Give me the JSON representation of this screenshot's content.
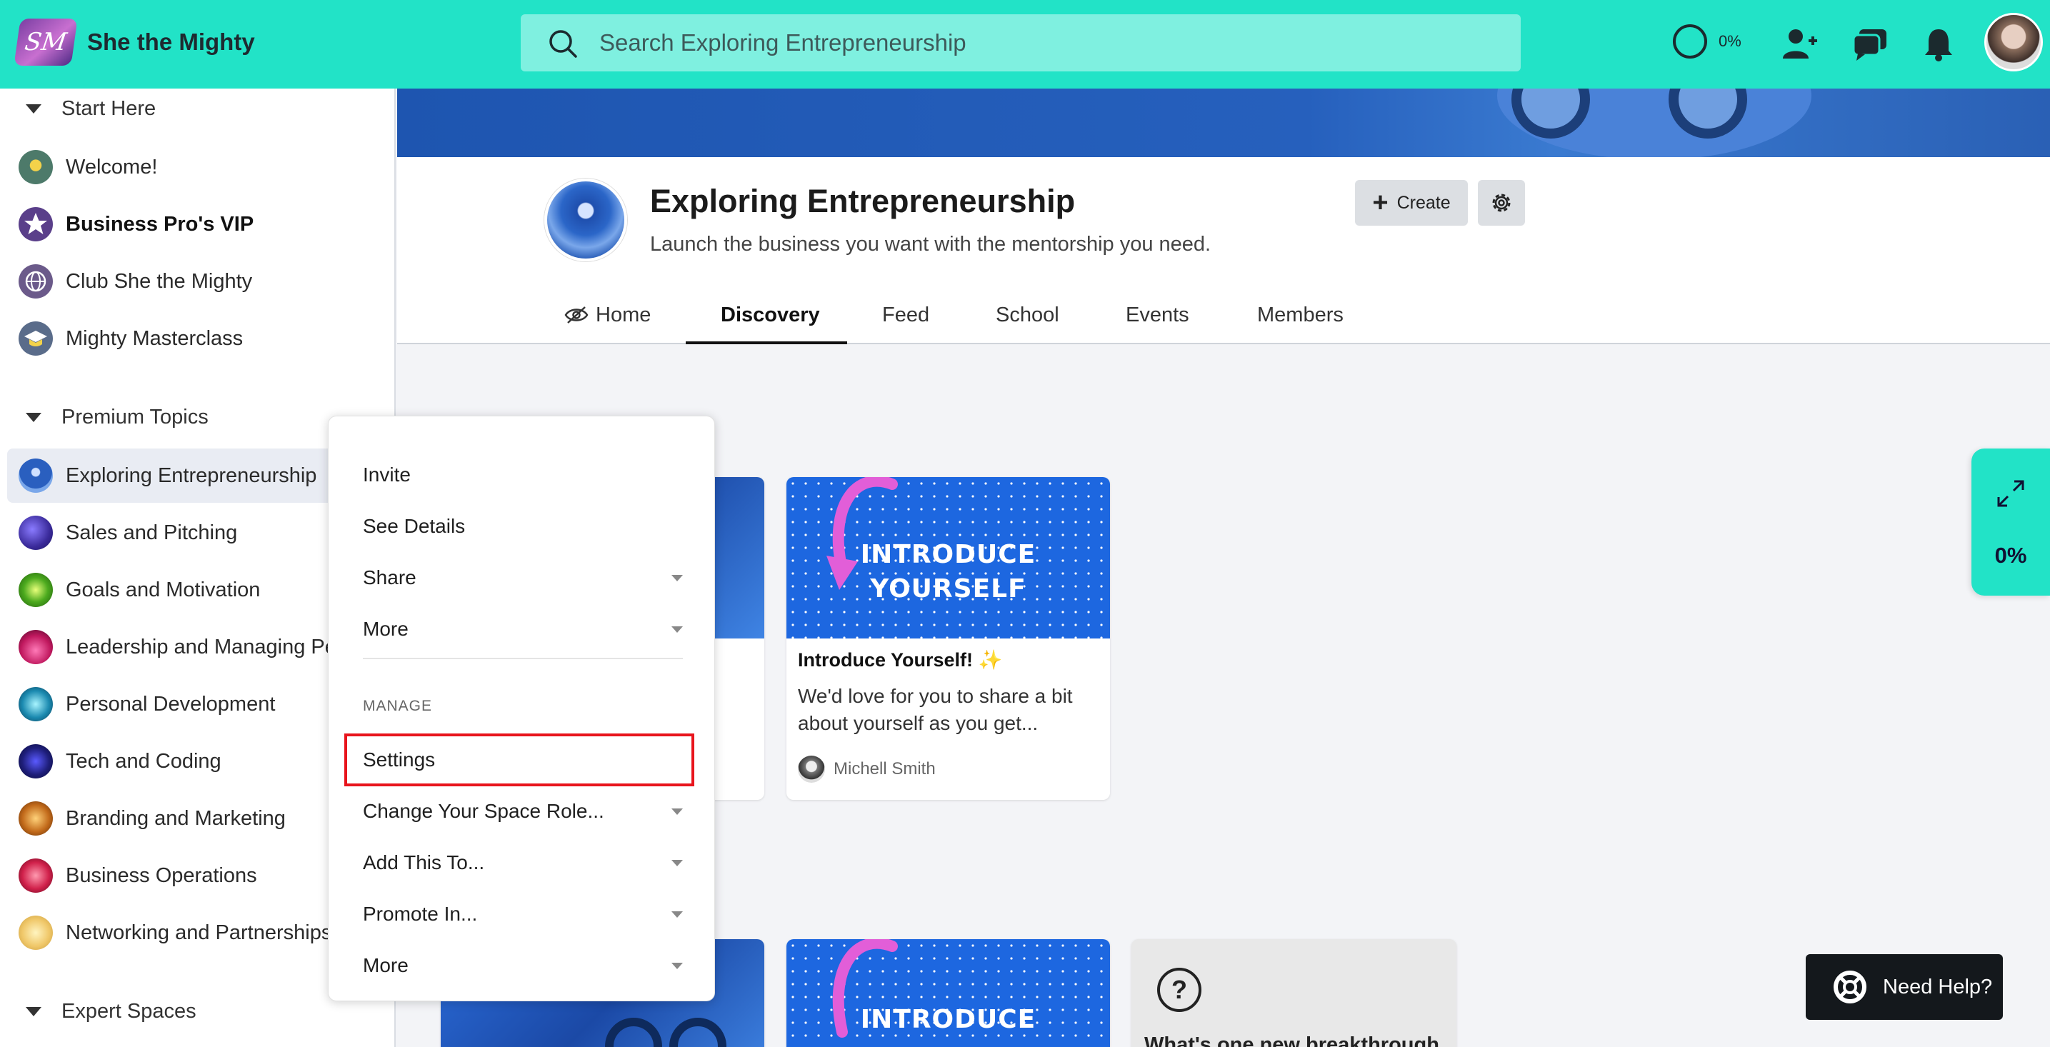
{
  "app": {
    "name": "She the Mighty",
    "logo_text": "SM"
  },
  "search": {
    "placeholder": "Search Exploring Entrepreneurship"
  },
  "top_progress": {
    "label": "0%",
    "value": 0
  },
  "sidebar": {
    "start_here": {
      "header": "Start Here",
      "items": [
        {
          "label": "Welcome!",
          "bold": false
        },
        {
          "label": "Business Pro's VIP",
          "bold": true
        },
        {
          "label": "Club She the Mighty",
          "bold": false
        },
        {
          "label": "Mighty Masterclass",
          "bold": false
        }
      ]
    },
    "premium_topics": {
      "header": "Premium Topics",
      "items": [
        {
          "label": "Exploring Entrepreneurship",
          "active": true
        },
        {
          "label": "Sales and Pitching"
        },
        {
          "label": "Goals and Motivation"
        },
        {
          "label": "Leadership and Managing People"
        },
        {
          "label": "Personal Development"
        },
        {
          "label": "Tech and Coding"
        },
        {
          "label": "Branding and Marketing"
        },
        {
          "label": "Business Operations"
        },
        {
          "label": "Networking and Partnerships"
        }
      ]
    },
    "expert_spaces": {
      "header": "Expert Spaces"
    }
  },
  "space": {
    "title": "Exploring Entrepreneurship",
    "subtitle": "Launch the business you want with the mentorship you need.",
    "create_label": "Create",
    "tabs": [
      "Home",
      "Discovery",
      "Feed",
      "School",
      "Events",
      "Members"
    ],
    "active_tab": "Discovery"
  },
  "cards": {
    "intro": {
      "image_text_line1": "INTRODUCE",
      "image_text_line2": "YOURSELF",
      "title": "Introduce Yourself! ✨",
      "body": "We'd love for you to share a bit about yourself as you get...",
      "author": "Michell Smith"
    },
    "question": {
      "title": "What's one new breakthrough"
    }
  },
  "context_menu": {
    "items": [
      {
        "label": "Invite",
        "caret": false
      },
      {
        "label": "See Details",
        "caret": false
      },
      {
        "label": "Share",
        "caret": true
      },
      {
        "label": "More",
        "caret": true
      }
    ],
    "section_label": "MANAGE",
    "manage_items": [
      {
        "label": "Settings",
        "caret": false,
        "highlighted": true
      },
      {
        "label": "Change Your Space Role...",
        "caret": true
      },
      {
        "label": "Add This To...",
        "caret": true
      },
      {
        "label": "Promote In...",
        "caret": true
      },
      {
        "label": "More",
        "caret": true
      }
    ]
  },
  "floating_progress": {
    "label": "0%",
    "value": 0
  },
  "help": {
    "label": "Need Help?"
  },
  "colors": {
    "accent": "#22e3c7",
    "highlight_border": "#e8141c",
    "card_blue": "#1d67e0"
  }
}
